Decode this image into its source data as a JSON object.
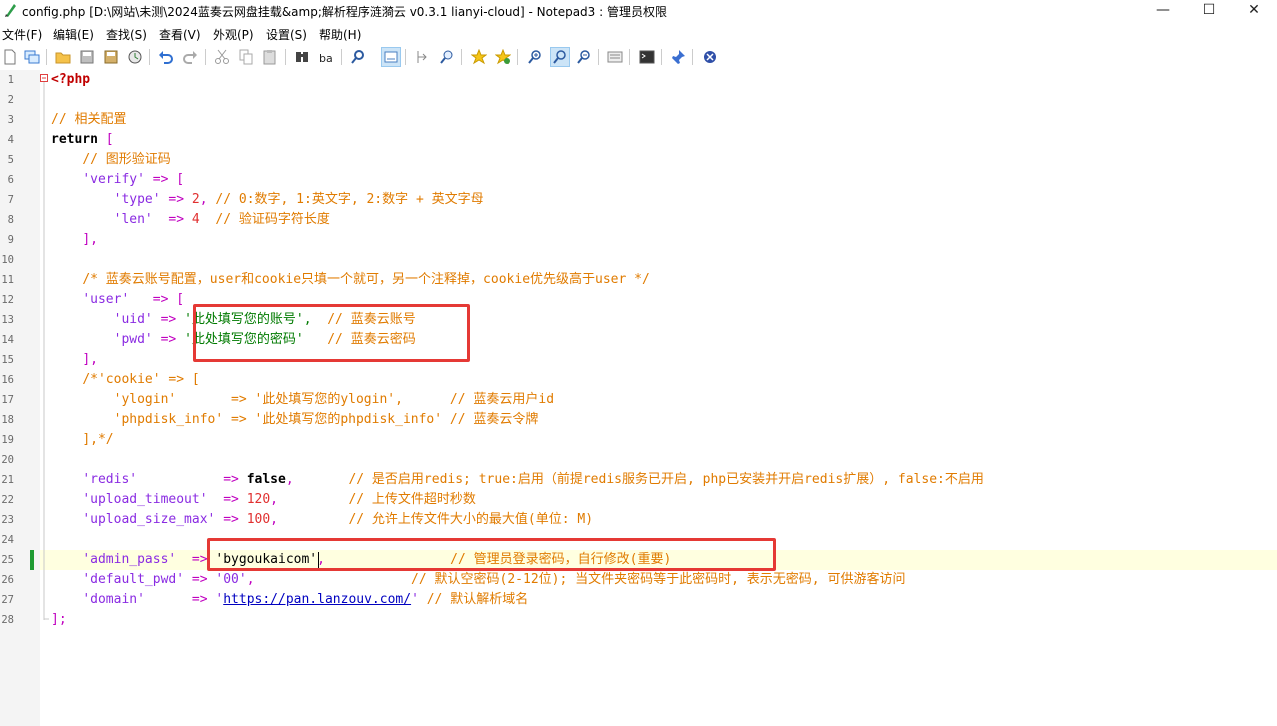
{
  "window": {
    "title": "config.php [D:\\网站\\未测\\2024蓝奏云网盘挂载&amp;解析程序涟漪云 v0.3.1 lianyi-cloud] - Notepad3 : 管理员权限",
    "minimize": "—",
    "maximize": "☐",
    "close": "✕"
  },
  "menu": [
    "文件(F)",
    "编辑(E)",
    "查找(S)",
    "查看(V)",
    "外观(P)",
    "设置(S)",
    "帮助(H)"
  ],
  "toolbar": {
    "icons": [
      "new-file-icon",
      "open-window-icon",
      "open-folder-icon",
      "save-icon",
      "save-as-icon",
      "save-copy-icon",
      "undo-icon",
      "redo-icon",
      "cut-icon",
      "copy-icon",
      "paste-icon",
      "find-icon",
      "replace-icon",
      "find-in-files-icon",
      "word-wrap-icon",
      "goto-icon",
      "zoom-search-icon",
      "favorite-add-icon",
      "favorite-icon",
      "zoom-in-icon",
      "zoom-reset-icon",
      "zoom-out-icon",
      "schema-icon",
      "terminal-icon",
      "pin-icon",
      "close-file-icon"
    ]
  },
  "editor": {
    "line_numbers": [
      "1",
      "2",
      "3",
      "4",
      "5",
      "6",
      "7",
      "8",
      "9",
      "10",
      "11",
      "12",
      "13",
      "14",
      "15",
      "16",
      "17",
      "18",
      "19",
      "20",
      "21",
      "22",
      "23",
      "24",
      "25",
      "26",
      "27",
      "28"
    ],
    "code": {
      "l1": "<?php",
      "l3": "// 相关配置",
      "l4_kw": "return",
      "l4_op": " [",
      "l5": "// 图形验证码",
      "l6_key": "'verify'",
      "l6_op": " => [",
      "l7_key": "'type'",
      "l7_op": " => ",
      "l7_num": "2",
      "l7_op2": ",",
      "l7_cm": " // 0:数字, 1:英文字, 2:数字 + 英文字母",
      "l8_key": "'len'",
      "l8_op": "  => ",
      "l8_num": "4",
      "l8_cm": "  // 验证码字符长度",
      "l9": "],",
      "l11": "/* 蓝奏云账号配置，user和cookie只填一个就可，另一个注释掉，cookie优先级高于user */",
      "l12_key": "'user'",
      "l12_op": "   => [",
      "l13_key": "'uid'",
      "l13_op": " => ",
      "l13_q": "'",
      "l13_val": "此处填写您的账号",
      "l13_q2": "',",
      "l13_cm": "  // 蓝奏云账号",
      "l14_key": "'pwd'",
      "l14_op": " => ",
      "l14_q": "'",
      "l14_val": "此处填写您的密码",
      "l14_q2": "'",
      "l14_cm": "   // 蓝奏云密码",
      "l15": "],",
      "l16": "/*'cookie' => [",
      "l17": "'ylogin'       => '此处填写您的ylogin',      // 蓝奏云用户id",
      "l18": "'phpdisk_info' => '此处填写您的phpdisk_info' // 蓝奏云令牌",
      "l19": "],*/",
      "l21_key": "'redis'",
      "l21_op": "           => ",
      "l21_bool": "false",
      "l21_op2": ",",
      "l21_cm": "       // 是否启用redis; true:启用（前提redis服务已开启, php已安装并开启redis扩展）, false:不启用",
      "l22_key": "'upload_timeout'",
      "l22_op": "  => ",
      "l22_num": "120",
      "l22_op2": ",",
      "l22_cm": "         // 上传文件超时秒数",
      "l23_key": "'upload_size_max'",
      "l23_op": " => ",
      "l23_num": "100",
      "l23_op2": ",",
      "l23_cm": "         // 允许上传文件大小的最大值(单位: M)",
      "l25_key": "'admin_pass'",
      "l25_op": "  =>",
      "l25_val": " 'bygoukaicom'",
      "l25_op2": ",",
      "l25_cm": "                // 管理员登录密码，自行修改(重要)",
      "l26_key": "'default_pwd'",
      "l26_op": " => ",
      "l26_val": "'00'",
      "l26_op2": ",",
      "l26_cm": "                    // 默认空密码(2-12位); 当文件夹密码等于此密码时, 表示无密码, 可供游客访问",
      "l27_key": "'domain'",
      "l27_op": "      => ",
      "l27_q": "'",
      "l27_url": "https://pan.lanzouv.com/",
      "l27_q2": "'",
      "l27_cm": " // 默认解析域名",
      "l28": "];"
    }
  }
}
